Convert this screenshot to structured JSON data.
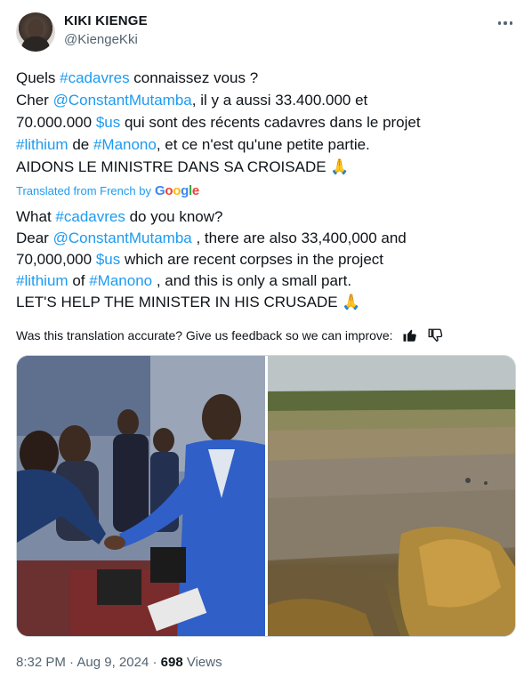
{
  "author": {
    "display_name": "KIKI KIENGE",
    "handle": "@KiengeKki"
  },
  "original_text": {
    "l1a": "Quels ",
    "l1tag": "#cadavres",
    "l1b": " connaissez vous ?",
    "l2a": "Cher ",
    "l2tag": "@ConstantMutamba",
    "l2b": ", il y a aussi 33.400.000 et",
    "l3a": "70.000.000 ",
    "l3tag": "$us",
    "l3b": " qui sont des récents cadavres dans le projet",
    "l4tag1": "#lithium",
    "l4a": " de ",
    "l4tag2": "#Manono",
    "l4b": ", et ce n'est qu'une petite partie.",
    "l5": "AIDONS LE MINISTRE DANS SA CROISADE 🙏"
  },
  "translated_from": "Translated from French by",
  "google": {
    "G": "G",
    "o1": "o",
    "o2": "o",
    "g": "g",
    "l": "l",
    "e": "e"
  },
  "translated_text": {
    "l1a": "What ",
    "l1tag": "#cadavres",
    "l1b": " do you know?",
    "l2a": "Dear ",
    "l2tag": "@ConstantMutamba",
    "l2b": " , there are also 33,400,000 and",
    "l3a": "70,000,000 ",
    "l3tag": "$us",
    "l3b": " which are recent corpses in the project",
    "l4tag1": "#lithium",
    "l4a": " of ",
    "l4tag2": "#Manono",
    "l4b": " , and this is only a small part.",
    "l5": "LET'S HELP THE MINISTER IN HIS CRUSADE 🙏"
  },
  "feedback_prompt": "Was this translation accurate? Give us feedback so we can improve:",
  "meta": {
    "time": "8:32 PM",
    "sep1": " · ",
    "date": "Aug 9, 2024",
    "sep2": " · ",
    "views_count": "698",
    "views_label": " Views"
  },
  "colors": {
    "link": "#1d9bf0",
    "text": "#0f1419",
    "secondary": "#536471"
  }
}
